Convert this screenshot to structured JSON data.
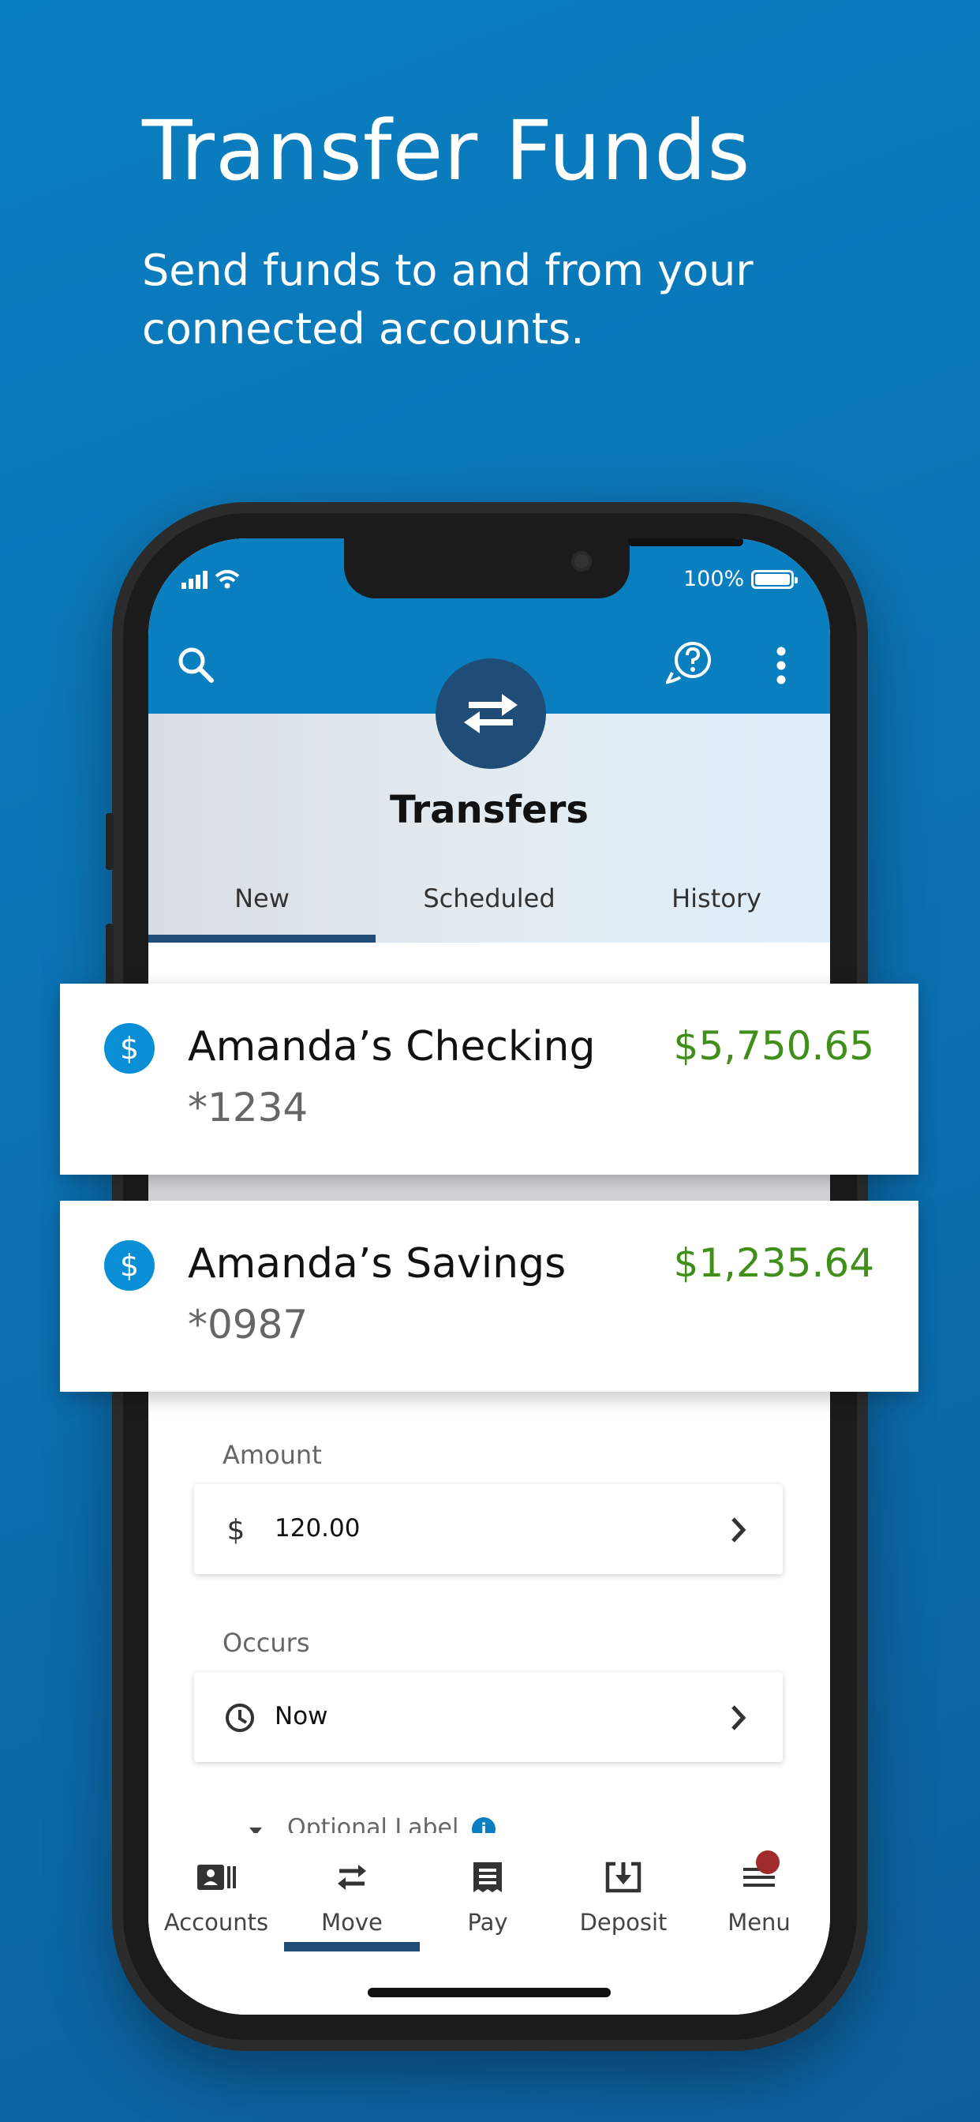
{
  "promo": {
    "headline": "Transfer Funds",
    "subline": "Send funds to and from your connected accounts."
  },
  "status_bar": {
    "battery": "100%"
  },
  "screen": {
    "title": "Transfers",
    "tabs": [
      {
        "label": "New",
        "active": true
      },
      {
        "label": "Scheduled",
        "active": false
      },
      {
        "label": "History",
        "active": false
      }
    ],
    "amount": {
      "label": "Amount",
      "value": "120.00"
    },
    "occurs": {
      "label": "Occurs",
      "value": "Now"
    },
    "optional_label": "Optional Label"
  },
  "accounts": [
    {
      "name": "Amanda’s Checking",
      "number": "*1234",
      "balance": "$5,750.65"
    },
    {
      "name": "Amanda’s Savings",
      "number": "*0987",
      "balance": "$1,235.64"
    }
  ],
  "bottom_nav": [
    {
      "label": "Accounts",
      "icon": "accounts-icon"
    },
    {
      "label": "Move",
      "icon": "transfer-icon",
      "active": true
    },
    {
      "label": "Pay",
      "icon": "receipt-icon"
    },
    {
      "label": "Deposit",
      "icon": "deposit-icon"
    },
    {
      "label": "Menu",
      "icon": "menu-icon"
    }
  ],
  "colors": {
    "brand_blue": "#0a7fc0",
    "navy": "#1f4d78",
    "balance_green": "#3f8f1a",
    "badge_red": "#a02b2b"
  }
}
